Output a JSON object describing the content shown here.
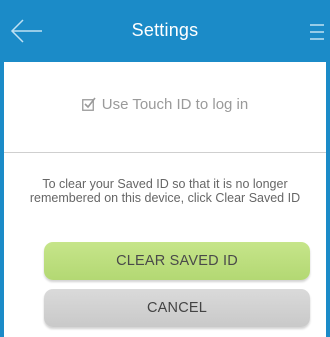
{
  "header": {
    "title": "Settings",
    "back_icon": "back-arrow-icon",
    "menu_icon": "menu-icon"
  },
  "touch_id": {
    "label": "Use Touch ID to log in",
    "checked": true
  },
  "saved_id": {
    "info_line1": "To clear your Saved ID so that it is no longer",
    "info_line2": "remembered on this device, click Clear Saved ID"
  },
  "buttons": {
    "clear": "CLEAR SAVED ID",
    "cancel": "CANCEL"
  },
  "colors": {
    "header": "#1b8bc8",
    "clear_button": "#bedf80",
    "cancel_button": "#d2d2d2"
  }
}
